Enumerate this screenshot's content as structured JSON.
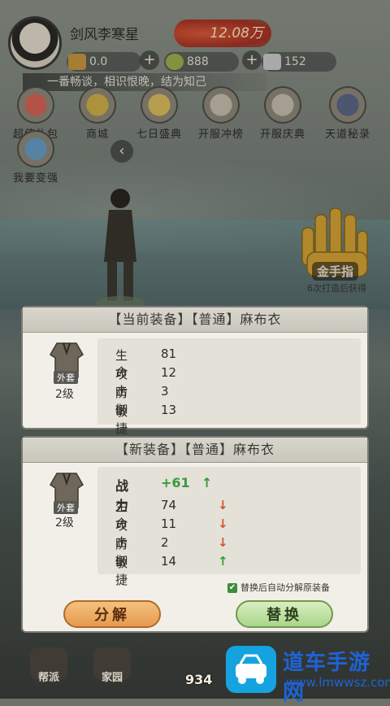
{
  "player": {
    "name": "剑风李寒星",
    "power": "12.08万"
  },
  "resources": [
    {
      "value": "0.0"
    },
    {
      "value": "888"
    },
    {
      "value": "152"
    }
  ],
  "plus": "+",
  "motto": "一番畅谈，相识恨晚，结为知己",
  "menu": [
    "超值礼包",
    "商城",
    "七日盛典",
    "开服冲榜",
    "开服庆典",
    "天道秘录",
    "我要变强"
  ],
  "back_arrow": "‹",
  "gold_hand": {
    "title": "金手指",
    "subtitle": "6次打造后获得"
  },
  "current": {
    "title": "【当前装备】【普通】麻布衣",
    "slot": "外套",
    "level": "2级",
    "stats": [
      {
        "name": "生命",
        "value": "81"
      },
      {
        "name": "攻击",
        "value": "12"
      },
      {
        "name": "防御",
        "value": "3"
      },
      {
        "name": "敏捷",
        "value": "13"
      }
    ]
  },
  "new_item": {
    "title": "【新装备】【普通】麻布衣",
    "slot": "外套",
    "level": "2级",
    "power_label": "战力",
    "power_delta": "+61",
    "stats": [
      {
        "name": "生命",
        "value": "74",
        "arrow": "↓"
      },
      {
        "name": "攻击",
        "value": "11",
        "arrow": "↓"
      },
      {
        "name": "防御",
        "value": "2",
        "arrow": "↓"
      },
      {
        "name": "敏捷",
        "value": "14",
        "arrow": "↑"
      }
    ],
    "power_arrow": "↑",
    "auto_decompose": "替换后自动分解原装备",
    "check_mark": "✔"
  },
  "buttons": {
    "decompose": "分解",
    "replace": "替换"
  },
  "bottom": {
    "nav1": "帮派",
    "nav2": "家园",
    "count": "934"
  },
  "watermark": {
    "title": "道车手游网",
    "url": "www.lmwwsz.com"
  }
}
